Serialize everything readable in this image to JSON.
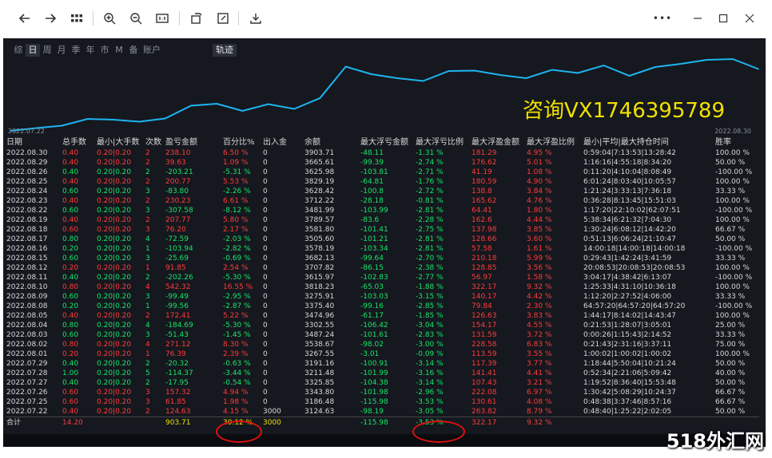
{
  "toolbar": {
    "more_label": "•••"
  },
  "tabs": [
    "综",
    "日",
    "周",
    "月",
    "季",
    "年",
    "市",
    "M",
    "备",
    "账户"
  ],
  "active_tab_index": 1,
  "track_label": "轨迹",
  "chart_data": {
    "type": "line",
    "x_start_label": "2022.07.22",
    "x_end_label": "2022.08.30",
    "color": "#1eb4f0",
    "values": [
      0,
      7,
      13,
      30,
      28,
      23,
      31,
      63,
      68,
      50,
      67,
      55,
      82,
      161,
      142,
      132,
      125,
      150,
      151,
      140,
      132,
      153,
      145,
      164,
      138,
      160,
      168,
      178,
      180,
      155
    ]
  },
  "overlay_text": "咨询VX1746395789",
  "columns": [
    "日期",
    "总手数",
    "最小|大手数",
    "次数",
    "盈亏金额",
    "百分比%",
    "出入金",
    "余额",
    "最大浮亏金额",
    "最大浮亏比例",
    "最大浮盈金额",
    "最大浮盈比例",
    "最小|平均|最大持仓时间",
    "胜率"
  ],
  "rows": [
    [
      "2022.08.30",
      "0.40",
      "0.20|0.20",
      "2",
      "238.10",
      "6.50 %",
      "0",
      "3903.71",
      "-48.11",
      "-1.31 %",
      "181.29",
      "4.95 %",
      "0:59:04|7:13:53|13:28:42",
      "100.00 %"
    ],
    [
      "2022.08.29",
      "0.40",
      "0.20|0.20",
      "2",
      "39.63",
      "1.09 %",
      "0",
      "3665.61",
      "-99.39",
      "-2.74 %",
      "176.62",
      "5.01 %",
      "1:16:16|4:55:18|8:34:20",
      "50.00 %"
    ],
    [
      "2022.08.26",
      "0.40",
      "0.20|0.20",
      "2",
      "-203.21",
      "-5.31 %",
      "0",
      "3625.98",
      "-103.81",
      "-2.71 %",
      "41.19",
      "1.08 %",
      "0:11:20|4:10:04|8:08:49",
      "-100.00 %"
    ],
    [
      "2022.08.25",
      "0.40",
      "0.20|0.20",
      "2",
      "200.77",
      "5.53 %",
      "0",
      "3829.19",
      "-64.81",
      "-1.76 %",
      "180.59",
      "4.90 %",
      "6:01:24|8:03:40|10:05:57",
      "100.00 %"
    ],
    [
      "2022.08.24",
      "0.60",
      "0.20|0.20",
      "3",
      "-83.80",
      "-2.26 %",
      "0",
      "3628.42",
      "-100.8",
      "-2.72 %",
      "138.8",
      "3.84 %",
      "1:21:24|3:33:13|7:36:18",
      "33.33 %"
    ],
    [
      "2022.08.23",
      "0.40",
      "0.20|0.20",
      "2",
      "230.23",
      "6.61 %",
      "0",
      "3712.22",
      "-28.18",
      "-0.81 %",
      "165.62",
      "4.76 %",
      "0:36:28|8:13:45|15:51:03",
      "100.00 %"
    ],
    [
      "2022.08.22",
      "0.60",
      "0.20|0.20",
      "3",
      "-307.58",
      "-8.12 %",
      "0",
      "3481.99",
      "-103.99",
      "-2.81 %",
      "64.41",
      "1.80 %",
      "1:17:20|22:10:02|62:07:51",
      "-100.00 %"
    ],
    [
      "2022.08.19",
      "0.40",
      "0.20|0.20",
      "2",
      "207.77",
      "5.80 %",
      "0",
      "3789.57",
      "-83.6",
      "-2.28 %",
      "162.6",
      "4.44 %",
      "5:38:34|6:21:32|7:04:30",
      "100.00 %"
    ],
    [
      "2022.08.18",
      "0.60",
      "0.20|0.20",
      "3",
      "76.20",
      "2.17 %",
      "0",
      "3581.80",
      "-101.41",
      "-2.75 %",
      "137.98",
      "3.85 %",
      "1:30:24|6:08:12|14:42:20",
      "66.67 %"
    ],
    [
      "2022.08.17",
      "0.80",
      "0.20|0.20",
      "4",
      "-72.59",
      "-2.03 %",
      "0",
      "3505.60",
      "-101.21",
      "-2.81 %",
      "128.66",
      "3.60 %",
      "0:51:13|6:06:24|21:10:47",
      "50.00 %"
    ],
    [
      "2022.08.16",
      "0.20",
      "0.20|0.20",
      "1",
      "-103.94",
      "-2.82 %",
      "0",
      "3578.19",
      "-103.34",
      "-2.81 %",
      "57.58",
      "1.61 %",
      "14:00:18|14:00:18|14:00:18",
      "-100.00 %"
    ],
    [
      "2022.08.15",
      "0.60",
      "0.20|0.20",
      "3",
      "-25.69",
      "-0.69 %",
      "0",
      "3682.13",
      "-99.64",
      "-2.70 %",
      "210.18",
      "5.99 %",
      "0:29:43|1:42:24|3:41:59",
      "33.33 %"
    ],
    [
      "2022.08.12",
      "0.20",
      "0.20|0.20",
      "1",
      "91.85",
      "2.54 %",
      "0",
      "3707.82",
      "-86.15",
      "-2.38 %",
      "128.85",
      "3.56 %",
      "20:08:53|20:08:53|20:08:53",
      "100.00 %"
    ],
    [
      "2022.08.11",
      "0.40",
      "0.20|0.20",
      "2",
      "-202.26",
      "-5.30 %",
      "0",
      "3615.97",
      "-102.83",
      "-2.77 %",
      "56.97",
      "1.58 %",
      "3:04:17|4:38:42|6:13:07",
      "-100.00 %"
    ],
    [
      "2022.08.10",
      "0.80",
      "0.20|0.20",
      "4",
      "542.32",
      "16.55 %",
      "0",
      "3818.23",
      "-65.03",
      "-1.88 %",
      "322.17",
      "9.32 %",
      "1:25:33|4:31:10|10:36:18",
      "100.00 %"
    ],
    [
      "2022.08.09",
      "0.60",
      "0.20|0.20",
      "3",
      "-99.49",
      "-2.95 %",
      "0",
      "3275.91",
      "-103.03",
      "-3.15 %",
      "140.17",
      "4.42 %",
      "1:12:20|2:27:52|4:06:00",
      "33.33 %"
    ],
    [
      "2022.08.08",
      "0.20",
      "0.20|0.20",
      "1",
      "-99.56",
      "-2.87 %",
      "0",
      "3375.40",
      "-99.16",
      "-2.85 %",
      "79.84",
      "2.30 %",
      "64:57:20|64:57:20|64:57:20",
      "-100.00 %"
    ],
    [
      "2022.08.05",
      "0.40",
      "0.20|0.20",
      "2",
      "172.41",
      "5.22 %",
      "0",
      "3474.96",
      "-61.17",
      "-1.85 %",
      "126.63",
      "3.83 %",
      "1:44:17|8:14:02|14:43:47",
      "100.00 %"
    ],
    [
      "2022.08.04",
      "0.80",
      "0.20|0.20",
      "4",
      "-184.69",
      "-5.30 %",
      "0",
      "3302.55",
      "-106.42",
      "-3.04 %",
      "154.17",
      "4.55 %",
      "0:21:53|1:28:07|3:05:01",
      "25.00 %"
    ],
    [
      "2022.08.03",
      "0.60",
      "0.20|0.20",
      "3",
      "-51.43",
      "-1.45 %",
      "0",
      "3487.24",
      "-101.61",
      "-2.83 %",
      "131.59",
      "3.72 %",
      "0:00:26|1:15:43|2:14:52",
      "33.33 %"
    ],
    [
      "2022.08.02",
      "0.80",
      "0.20|0.20",
      "4",
      "271.12",
      "8.30 %",
      "0",
      "3538.67",
      "-98.02",
      "-3.00 %",
      "228.58",
      "6.83 %",
      "0:21:43|2:31:16|3:37:11",
      "75.00 %"
    ],
    [
      "2022.08.01",
      "0.20",
      "0.20|0.20",
      "1",
      "76.39",
      "2.39 %",
      "0",
      "3267.55",
      "-3.01",
      "-0.09 %",
      "113.59",
      "3.55 %",
      "1:00:02|1:00:02|1:00:02",
      "100.00 %"
    ],
    [
      "2022.07.29",
      "0.40",
      "0.20|0.20",
      "2",
      "-20.32",
      "-0.63 %",
      "0",
      "3191.16",
      "-100.91",
      "-3.14 %",
      "117.39",
      "3.77 %",
      "1:18:44|5:50:04|10:21:24",
      "50.00 %"
    ],
    [
      "2022.07.28",
      "1.00",
      "0.20|0.20",
      "5",
      "-114.37",
      "-3.44 %",
      "0",
      "3211.48",
      "-101.99",
      "-3.16 %",
      "141.41",
      "4.41 %",
      "0:52:34|2:21:06|5:09:42",
      "40.00 %"
    ],
    [
      "2022.07.27",
      "0.40",
      "0.20|0.20",
      "2",
      "-17.95",
      "-0.54 %",
      "0",
      "3325.85",
      "-104.38",
      "-3.14 %",
      "107.43",
      "3.21 %",
      "1:19:52|8:36:40|15:53:48",
      "50.00 %"
    ],
    [
      "2022.07.26",
      "0.60",
      "0.20|0.20",
      "3",
      "157.32",
      "4.94 %",
      "0",
      "3343.80",
      "-101.98",
      "-2.96 %",
      "222.08",
      "6.97 %",
      "1:30:42|5:08:29|10:24:37",
      "66.67 %"
    ],
    [
      "2022.07.25",
      "0.60",
      "0.20|0.20",
      "3",
      "61.85",
      "1.98 %",
      "0",
      "3186.48",
      "-115.98",
      "-3.53 %",
      "130.61",
      "4.08 %",
      "0:48:38|3:37:46|8:57:16",
      "66.67 %"
    ],
    [
      "2022.07.22",
      "0.40",
      "0.20|0.20",
      "2",
      "124.63",
      "4.15 %",
      "3000",
      "3124.63",
      "-98.19",
      "-3.05 %",
      "263.82",
      "8.79 %",
      "0:48:40|1:25:22|2:02:05",
      "50.00 %"
    ]
  ],
  "total": [
    "合计",
    "14.20",
    "",
    "",
    "903.71",
    "30.12 %",
    "3000",
    "",
    "-115.98",
    "-3.53 %",
    "322.17",
    "9.32 %",
    "",
    ""
  ],
  "brand_text": "518外汇网"
}
